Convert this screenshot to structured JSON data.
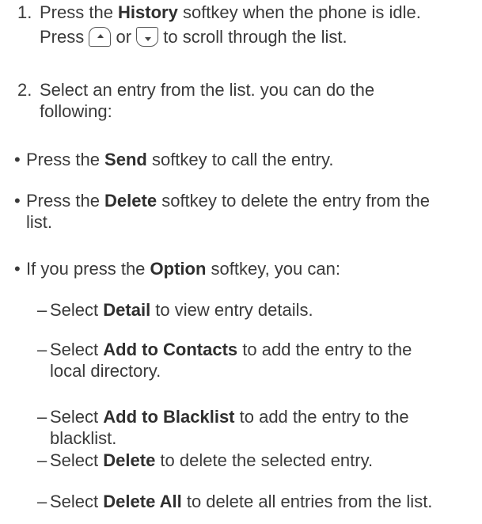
{
  "step1": {
    "number": "1.",
    "line1_pre": "Press the ",
    "line1_bold": "History",
    "line1_post": " softkey when the phone is idle.",
    "line2_pre": "Press ",
    "line2_mid": " or ",
    "line2_post": " to scroll through the list.",
    "up_key_icon": "up-arrow-key-icon",
    "down_key_icon": "down-arrow-key-icon"
  },
  "step2": {
    "number": "2.",
    "text_line1": "Select an entry from the list. you can do the",
    "text_line2": "following:"
  },
  "bullets": [
    {
      "pre": "Press the ",
      "bold": "Send",
      "post": " softkey to call the entry."
    },
    {
      "pre": "Press the ",
      "bold": "Delete",
      "post": " softkey to delete the entry from the",
      "line2": "list."
    },
    {
      "pre": "If you press the ",
      "bold": "Option",
      "post": " softkey, you can:"
    }
  ],
  "bullet_char": "•",
  "dash_char": "–",
  "sub_items": [
    {
      "pre": "Select ",
      "bold": "Detail",
      "post": " to view entry details."
    },
    {
      "pre": "Select ",
      "bold": "Add to Contacts",
      "post": " to add the entry to the",
      "line2": "local directory."
    },
    {
      "pre": "Select ",
      "bold": "Add to Blacklist",
      "post": " to add the entry to the",
      "line2": "blacklist."
    },
    {
      "pre": "Select ",
      "bold": "Delete",
      "post": " to delete the selected entry."
    },
    {
      "pre": "Select ",
      "bold": "Delete All",
      "post": " to delete all entries from the list."
    }
  ]
}
